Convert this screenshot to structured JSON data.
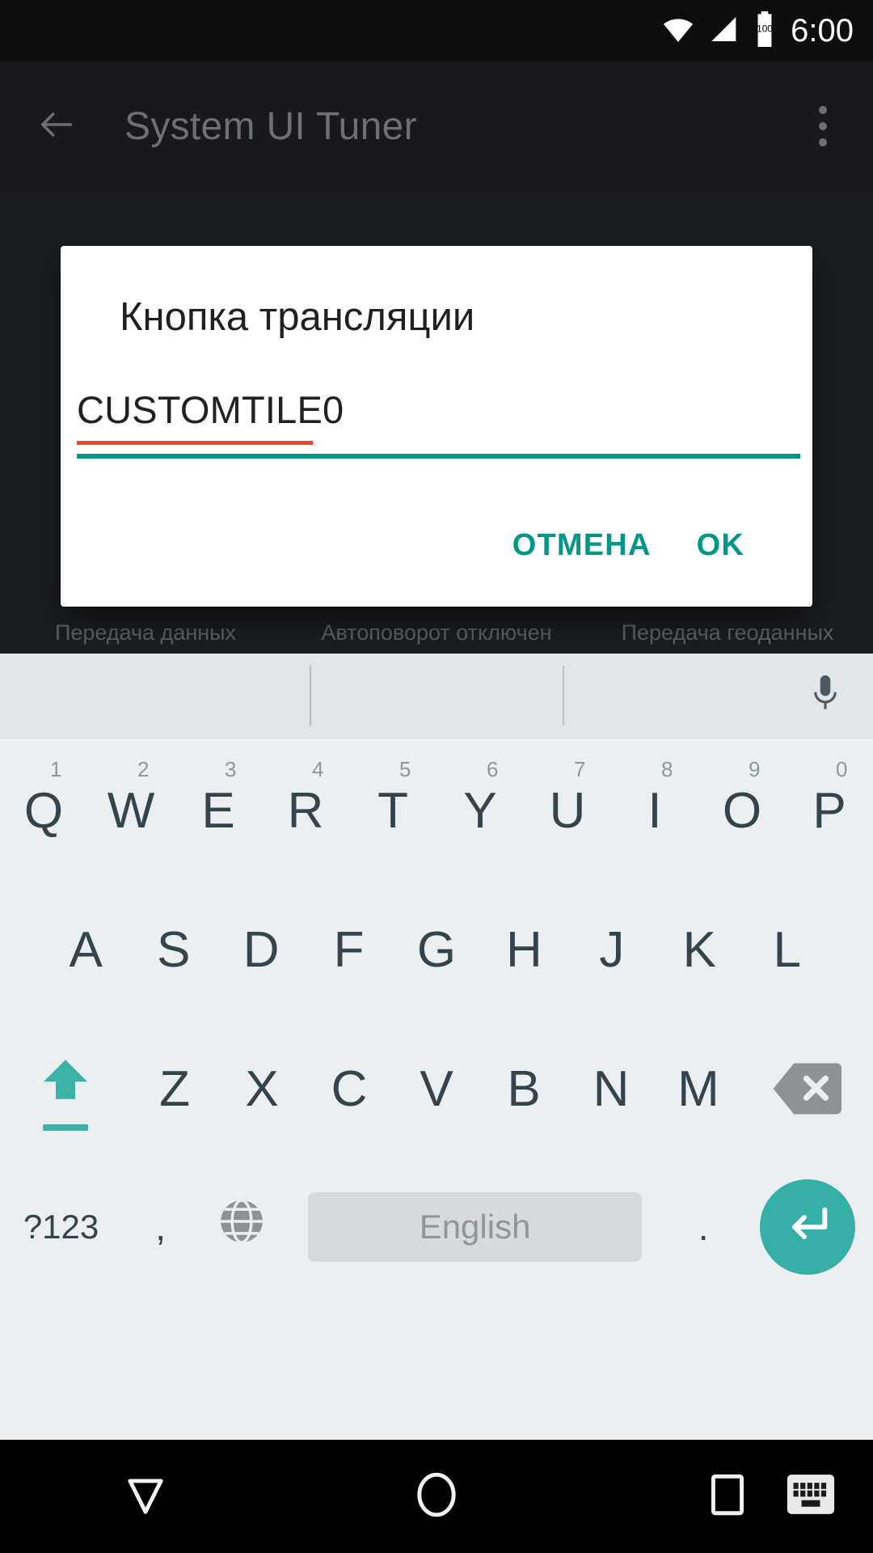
{
  "status_bar": {
    "clock": "6:00",
    "icons": [
      "wifi-icon",
      "signal-icon",
      "battery-icon"
    ],
    "battery_level_label": "100"
  },
  "app_bar": {
    "back_icon": "back-arrow-icon",
    "title": "System UI Tuner",
    "overflow_icon": "overflow-menu-icon"
  },
  "dialog": {
    "title": "Кнопка трансляции",
    "input_value": "CUSTOMTILE0",
    "input_placeholder": "",
    "spellcheck_underline_color": "#f44336",
    "focus_underline_color": "#009688",
    "buttons": {
      "cancel": "ОТМЕНА",
      "ok": "OK"
    },
    "accent_color": "#009688"
  },
  "quick_settings": {
    "tiles": [
      {
        "icon": "cell-data-icon",
        "label": "Передача данных"
      },
      {
        "icon": "auto-rotate-icon",
        "label": "Автоповорот отключен"
      },
      {
        "icon": "location-off-icon",
        "label": "Передача геоданных"
      }
    ]
  },
  "keyboard": {
    "suggestion_strip": {
      "suggestions": [
        "",
        "",
        ""
      ],
      "mic_icon": "microphone-icon"
    },
    "row1": [
      {
        "letter": "Q",
        "num": "1"
      },
      {
        "letter": "W",
        "num": "2"
      },
      {
        "letter": "E",
        "num": "3"
      },
      {
        "letter": "R",
        "num": "4"
      },
      {
        "letter": "T",
        "num": "5"
      },
      {
        "letter": "Y",
        "num": "6"
      },
      {
        "letter": "U",
        "num": "7"
      },
      {
        "letter": "I",
        "num": "8"
      },
      {
        "letter": "O",
        "num": "9"
      },
      {
        "letter": "P",
        "num": "0"
      }
    ],
    "row2": [
      {
        "letter": "A"
      },
      {
        "letter": "S"
      },
      {
        "letter": "D"
      },
      {
        "letter": "F"
      },
      {
        "letter": "G"
      },
      {
        "letter": "H"
      },
      {
        "letter": "J"
      },
      {
        "letter": "K"
      },
      {
        "letter": "L"
      }
    ],
    "row3": {
      "shift_icon": "shift-caps-lock-icon",
      "letters": [
        {
          "letter": "Z"
        },
        {
          "letter": "X"
        },
        {
          "letter": "C"
        },
        {
          "letter": "V"
        },
        {
          "letter": "B"
        },
        {
          "letter": "N"
        },
        {
          "letter": "M"
        }
      ],
      "delete_icon": "backspace-icon"
    },
    "row4": {
      "symbols_label": "?123",
      "comma_label": ",",
      "globe_icon": "language-globe-icon",
      "space_label": "English",
      "period_label": ".",
      "enter_icon": "enter-key-icon"
    },
    "shift_active_color": "#3bb2a6",
    "enter_key_color": "#36b0a6",
    "key_text_color": "#34444c"
  },
  "nav_bar": {
    "back_icon": "nav-back-down-icon",
    "home_icon": "nav-home-icon",
    "recents_icon": "nav-recents-icon",
    "hide_keyboard_icon": "hide-keyboard-icon"
  }
}
